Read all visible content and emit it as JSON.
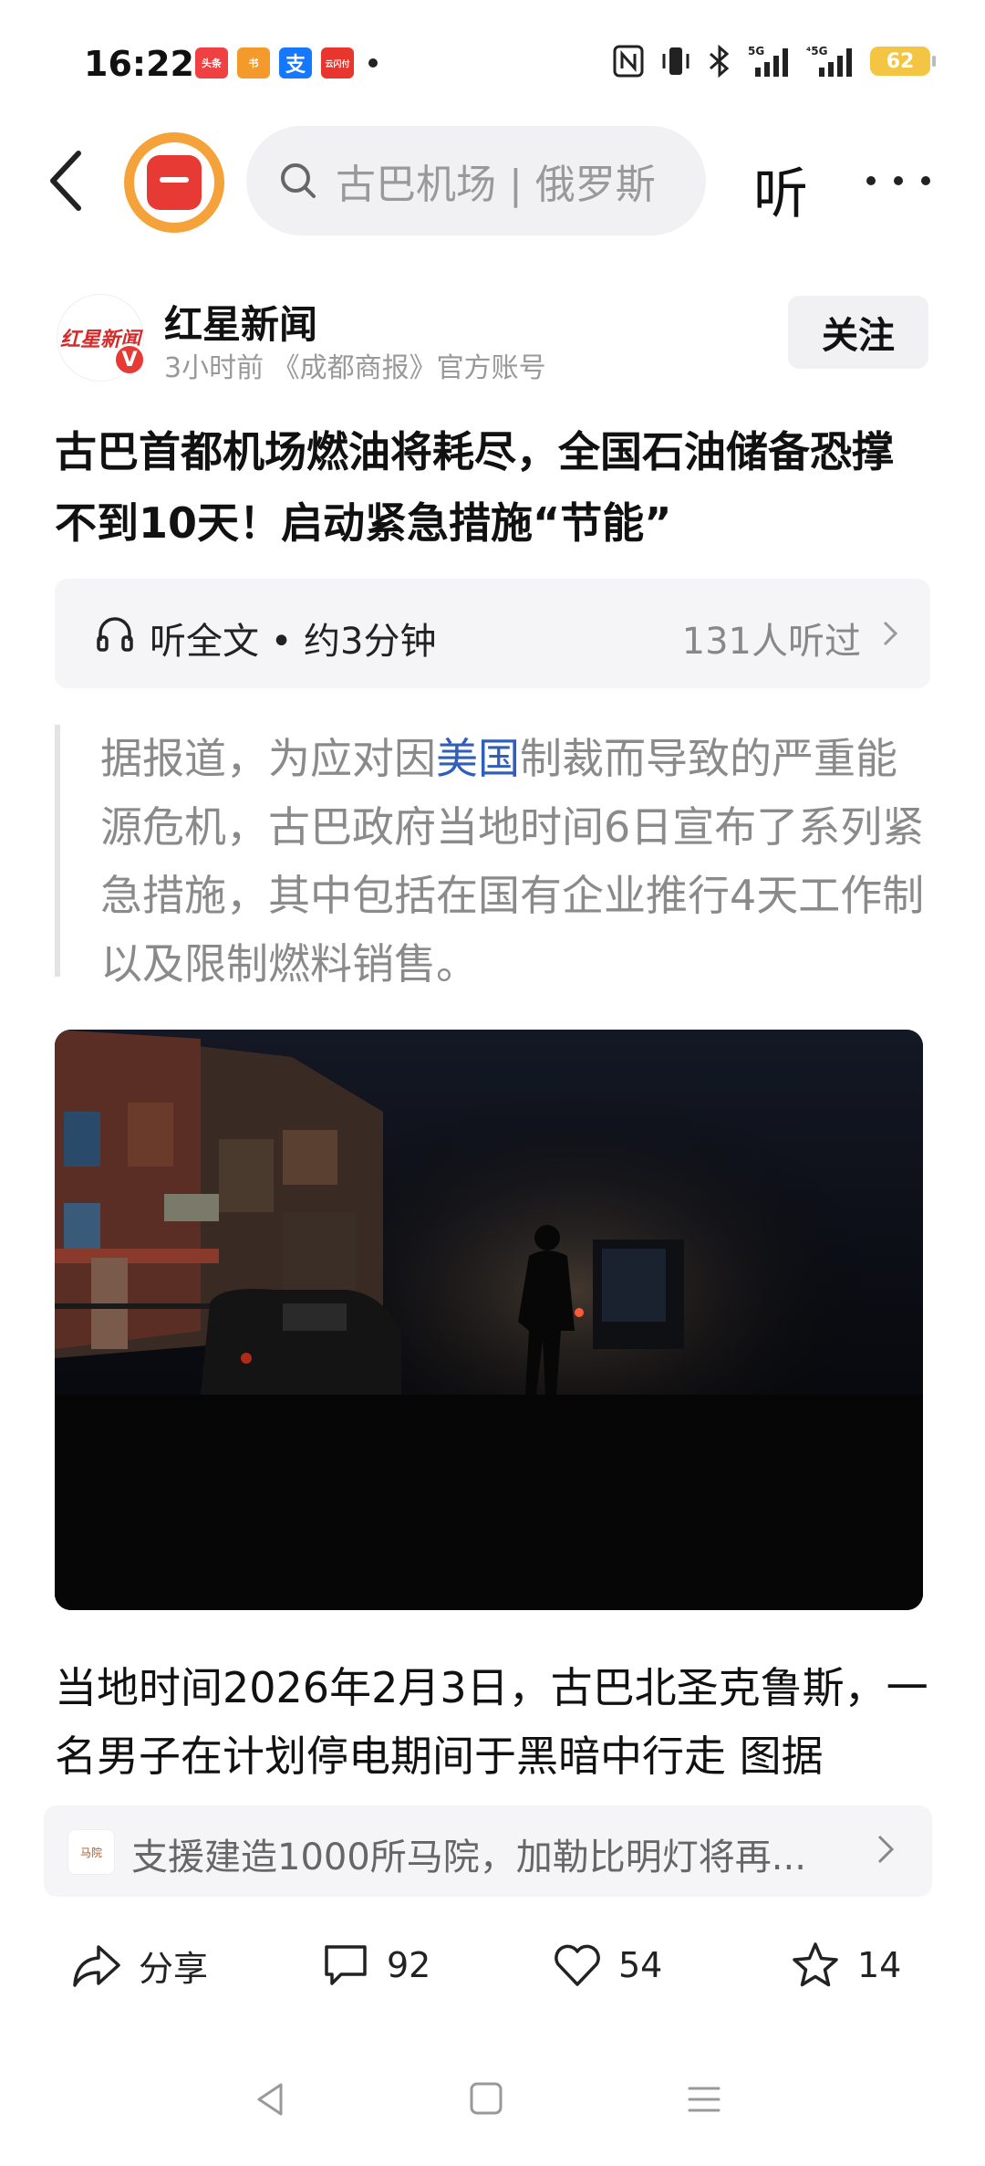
{
  "status_bar": {
    "time": "16:22",
    "notification_apps": [
      "头条",
      "书",
      "支",
      "云闪付"
    ],
    "battery": "62"
  },
  "topnav": {
    "search_placeholder": "古巴机场 | 俄罗斯",
    "listen_label": "听"
  },
  "author": {
    "avatar_text": "红星新闻",
    "name": "红星新闻",
    "meta": "3小时前  《成都商报》官方账号",
    "follow_label": "关注",
    "badge": "V"
  },
  "article": {
    "title": "古巴首都机场燃油将耗尽，全国石油储备恐撑不到10天！启动紧急措施“节能”",
    "listen_bar": {
      "label": "听全文 • 约3分钟",
      "count": "131人听过"
    },
    "quote": {
      "before_link": "据报道，为应对因",
      "link": "美国",
      "after_link": "制裁而导致的严重能源危机，古巴政府当地时间6日宣布了系列紧急措施，其中包括在国有企业推行4天工作制以及限制燃料销售。"
    },
    "caption": "当地时间2026年2月3日，古巴北圣克鲁斯，一名男子在计划停电期间于黑暗中行走 图据"
  },
  "related": {
    "icon_text": "马院",
    "text": "支援建造1000所马院，加勒比明灯将再..."
  },
  "actions": {
    "share": "分享",
    "comments": "92",
    "likes": "54",
    "favorites": "14"
  }
}
